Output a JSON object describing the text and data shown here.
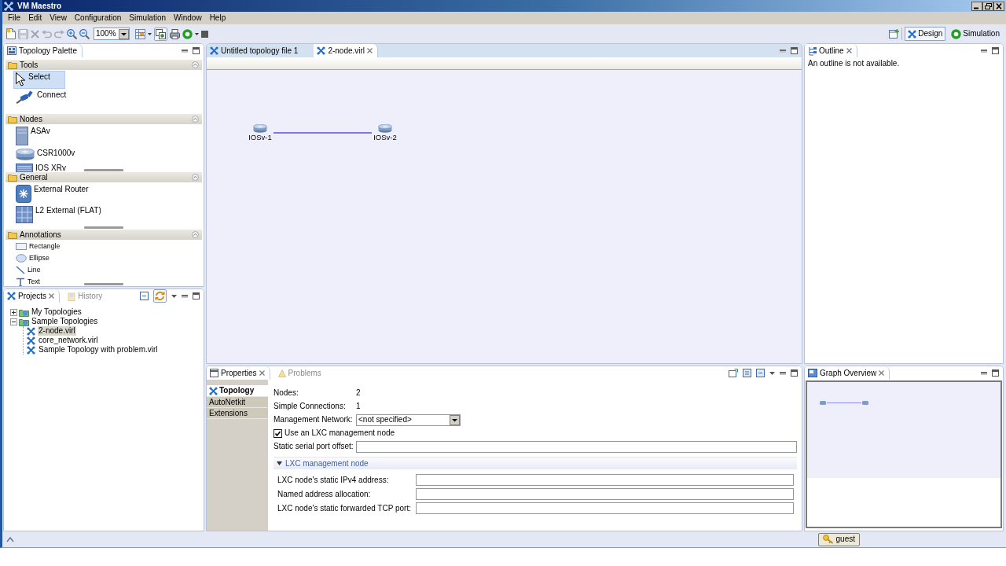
{
  "window": {
    "title": "VM Maestro"
  },
  "menu": [
    "File",
    "Edit",
    "View",
    "Configuration",
    "Simulation",
    "Window",
    "Help"
  ],
  "toolbar": {
    "left": [
      {
        "kind": "new",
        "disabled": false,
        "pressed": false
      },
      {
        "kind": "save",
        "disabled": true,
        "pressed": false
      },
      {
        "kind": "delete",
        "disabled": true,
        "pressed": false
      },
      {
        "kind": "undo",
        "disabled": true,
        "pressed": false
      },
      {
        "kind": "redo",
        "disabled": true,
        "pressed": false
      },
      {
        "kind": "zoom-in",
        "disabled": false,
        "pressed": false
      },
      {
        "kind": "zoom-out",
        "disabled": false,
        "pressed": false
      }
    ],
    "zoom": "100%",
    "right": [
      {
        "kind": "layout",
        "disabled": false,
        "pressed": false
      },
      {
        "kind": "caret",
        "disabled": false,
        "pressed": false
      },
      {
        "kind": "layers",
        "disabled": false,
        "pressed": true
      },
      {
        "kind": "stack",
        "disabled": false,
        "pressed": false
      },
      {
        "kind": "start",
        "disabled": false,
        "pressed": false
      },
      {
        "kind": "caret",
        "disabled": false,
        "pressed": false
      },
      {
        "kind": "stop",
        "disabled": false,
        "pressed": false
      }
    ],
    "perspectives": [
      {
        "label": "Design",
        "kind": "design",
        "selected": true
      },
      {
        "label": "Simulation",
        "kind": "simulation",
        "selected": false
      }
    ]
  },
  "palette": {
    "active": false,
    "tabs": [
      {
        "label": "Topology Palette",
        "kind": "palette",
        "selected": true,
        "closable": false
      }
    ],
    "drawers": [
      {
        "label": "Tools",
        "expanded": true,
        "scrollbar": false,
        "items": [
          {
            "label": "Select",
            "kind": "pointer",
            "selected": true
          },
          {
            "label": "Connect",
            "kind": "cable",
            "selected": false
          }
        ]
      },
      {
        "label": "Nodes",
        "expanded": true,
        "scrollbar": true,
        "items": [
          {
            "label": "ASAv",
            "kind": "appliance",
            "selected": false
          },
          {
            "label": "CSR1000v",
            "kind": "router",
            "selected": false
          },
          {
            "label": "IOS XRv",
            "kind": "chassis",
            "selected": false
          }
        ]
      },
      {
        "label": "General",
        "expanded": true,
        "scrollbar": true,
        "items": [
          {
            "label": "External Router",
            "kind": "external-router",
            "selected": false
          },
          {
            "label": "L2 External (FLAT)",
            "kind": "flat",
            "selected": false
          }
        ]
      },
      {
        "label": "Annotations",
        "expanded": true,
        "scrollbar": true,
        "items": [
          {
            "label": "Rectangle",
            "kind": "rectangle",
            "selected": false
          },
          {
            "label": "Ellipse",
            "kind": "ellipse",
            "selected": false
          },
          {
            "label": "Line",
            "kind": "line",
            "selected": false
          },
          {
            "label": "Text",
            "kind": "text",
            "selected": false
          }
        ]
      }
    ]
  },
  "projects": {
    "active": false,
    "tabs": [
      {
        "label": "Projects",
        "kind": "projects",
        "selected": true,
        "closable": true
      },
      {
        "label": "History",
        "kind": "history",
        "selected": false,
        "closable": false
      }
    ],
    "tools": [
      {
        "kind": "collapse-all",
        "pressed": false
      },
      {
        "kind": "link",
        "pressed": true
      }
    ],
    "tree": [
      {
        "label": "My Topologies",
        "kind": "folder",
        "expanded": false,
        "selected": false
      },
      {
        "label": "Sample Topologies",
        "kind": "folder",
        "expanded": true,
        "selected": false,
        "children": [
          {
            "label": "2-node.virl",
            "kind": "file",
            "selected": true
          },
          {
            "label": "core_network.virl",
            "kind": "file",
            "selected": false
          },
          {
            "label": "Sample Topology with problem.virl",
            "kind": "file",
            "selected": false
          }
        ]
      }
    ]
  },
  "editor": {
    "active": true,
    "tabs": [
      {
        "label": "Untitled topology file 1",
        "kind": "topology",
        "selected": false,
        "closable": false
      },
      {
        "label": "2-node.virl",
        "kind": "topology",
        "selected": true,
        "closable": true
      }
    ],
    "nodes": [
      {
        "label": "IOSv-1",
        "kind": "router",
        "linked": true
      },
      {
        "label": "IOSv-2",
        "kind": "router",
        "linked": true
      }
    ]
  },
  "outline": {
    "active": false,
    "tabs": [
      {
        "label": "Outline",
        "kind": "outline",
        "selected": true,
        "closable": true
      }
    ],
    "message": "An outline is not available."
  },
  "properties": {
    "active": false,
    "tabs": [
      {
        "label": "Properties",
        "kind": "properties",
        "selected": true,
        "closable": true
      },
      {
        "label": "Problems",
        "kind": "problems",
        "selected": false,
        "closable": false
      }
    ],
    "sections": [
      {
        "label": "Topology",
        "kind": "network",
        "selected": true
      },
      {
        "label": "AutoNetkit",
        "kind": "plain",
        "selected": false
      },
      {
        "label": "Extensions",
        "kind": "plain",
        "selected": false
      }
    ],
    "fields": [
      {
        "kind": "value",
        "label": "Nodes:",
        "value": "2"
      },
      {
        "kind": "value",
        "label": "Simple Connections:",
        "value": "1"
      },
      {
        "kind": "select",
        "label": "Management Network:",
        "value": "<not specified>"
      },
      {
        "kind": "checkbox",
        "label": "Use an LXC management node",
        "checked": true
      },
      {
        "kind": "text",
        "label": "Static serial port offset:"
      }
    ],
    "group": {
      "label": "LXC management node",
      "expanded": true,
      "fields": [
        {
          "kind": "text",
          "label": "LXC node's static IPv4 address:"
        },
        {
          "kind": "text",
          "label": "Named address allocation:"
        },
        {
          "kind": "text",
          "label": "LXC node's static forwarded TCP port:"
        }
      ]
    }
  },
  "graph_overview": {
    "active": false,
    "tabs": [
      {
        "label": "Graph Overview",
        "kind": "overview",
        "selected": true,
        "closable": true
      }
    ]
  },
  "status_bar": {
    "user": "guest"
  }
}
